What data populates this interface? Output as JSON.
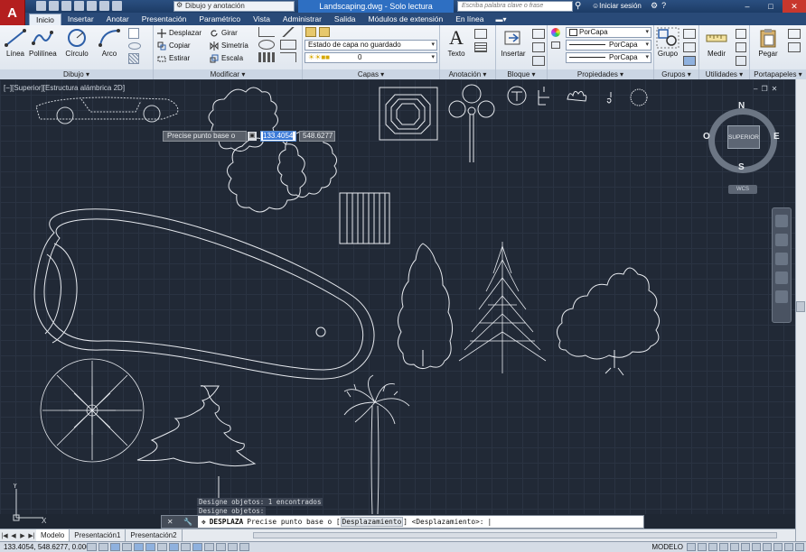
{
  "app": {
    "logo_letter": "A"
  },
  "titlebar": {
    "workspace": "Dibujo y anotación",
    "title": "Landscaping.dwg - Solo lectura",
    "search_placeholder": "Escriba palabra clave o frase",
    "login": "Iniciar sesión"
  },
  "tabs": [
    "Inicio",
    "Insertar",
    "Anotar",
    "Presentación",
    "Paramétrico",
    "Vista",
    "Administrar",
    "Salida",
    "Módulos de extensión",
    "En línea"
  ],
  "ribbon": {
    "draw": {
      "title": "Dibujo",
      "line": "Línea",
      "polyline": "Polilínea",
      "circle": "Círculo",
      "arc": "Arco"
    },
    "modify": {
      "title": "Modificar",
      "move": "Desplazar",
      "rotate": "Girar",
      "copy": "Copiar",
      "mirror": "Simetría",
      "stretch": "Estirar",
      "scale": "Escala"
    },
    "layers": {
      "title": "Capas",
      "state": "Estado de capa no guardado",
      "layer": "0"
    },
    "annotation": {
      "title": "Anotación",
      "text": "Texto"
    },
    "block": {
      "title": "Bloque",
      "insert": "Insertar"
    },
    "properties": {
      "title": "Propiedades",
      "color": "PorCapa",
      "linetype": "PorCapa",
      "lineweight": "PorCapa"
    },
    "groups": {
      "title": "Grupos",
      "group": "Grupo"
    },
    "utilities": {
      "title": "Utilidades",
      "measure": "Medir"
    },
    "clipboard": {
      "title": "Portapapeles",
      "paste": "Pegar"
    }
  },
  "viewport": {
    "label": "[−][Superior][Estructura alámbrica 2D]",
    "viewcube": {
      "face": "SUPERIOR",
      "n": "N",
      "s": "S",
      "e": "E",
      "w": "O",
      "wcs": "WCS"
    }
  },
  "dynamic_input": {
    "prompt": "Precise punto base o",
    "x": "133.4054",
    "y": "548.6277"
  },
  "command_history": [
    "Designe objetos: 1 encontrados",
    "Designe objetos:"
  ],
  "command_line": {
    "command": "DESPLAZA",
    "text": "Precise punto base o [",
    "option": "Desplazamiento",
    "text2": "] <Desplazamiento>:"
  },
  "ucs": {
    "y": "Y",
    "x": "X"
  },
  "layout_tabs": [
    "Modelo",
    "Presentación1",
    "Presentación2"
  ],
  "status": {
    "coords": "133.4054, 548.6277, 0.0000",
    "mode": "MODELO"
  },
  "colors": {
    "canvas": "#212936",
    "drawing_lines": "#e6e9ee",
    "accent": "#2e6fc2"
  }
}
